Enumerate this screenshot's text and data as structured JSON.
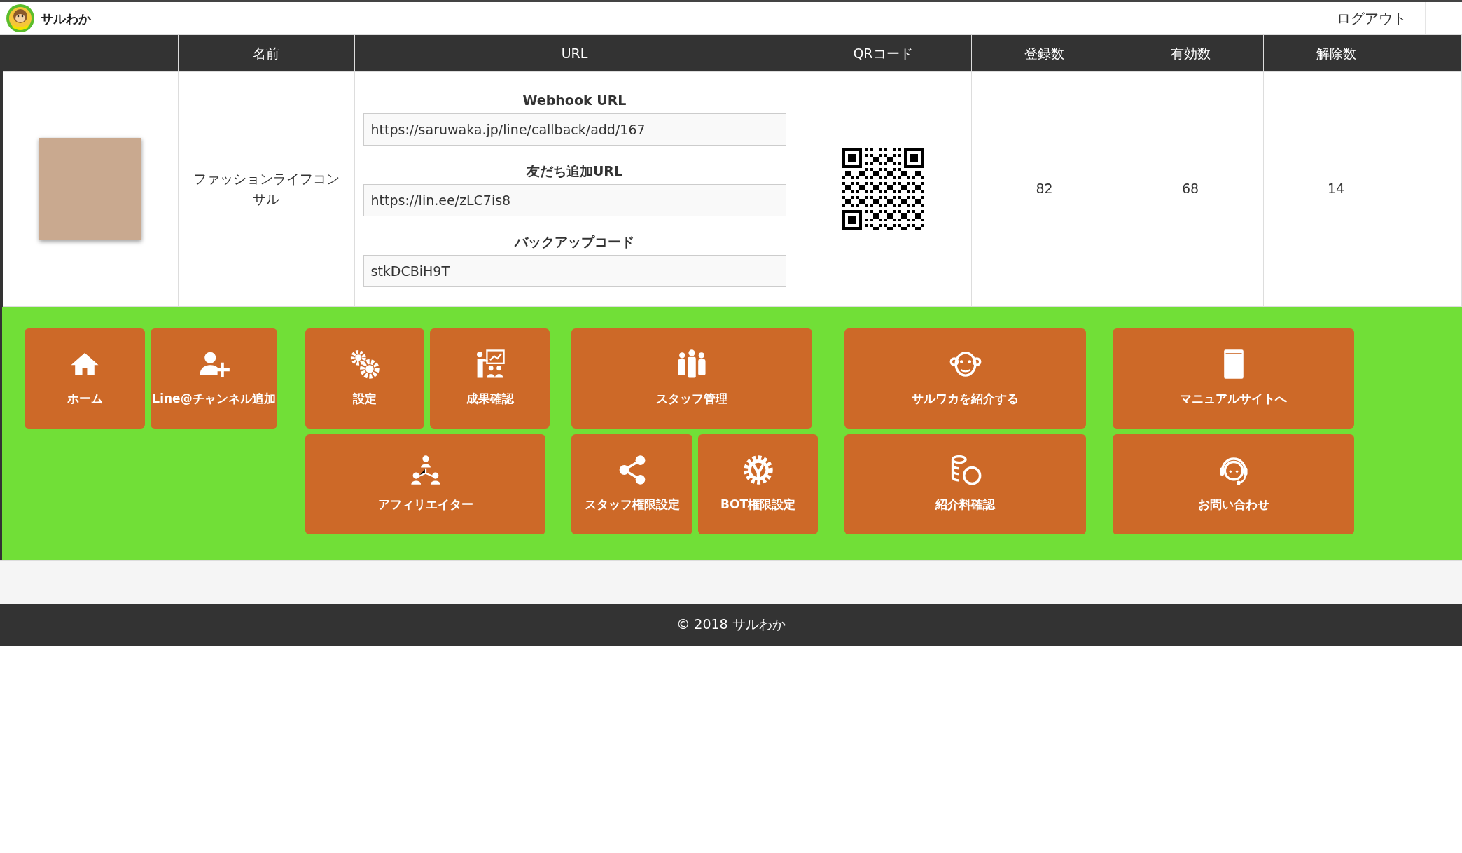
{
  "header": {
    "logo_text": "サルわか",
    "logout": "ログアウト"
  },
  "table": {
    "columns": [
      "名前",
      "URL",
      "QRコード",
      "登録数",
      "有効数",
      "解除数"
    ],
    "rows": [
      {
        "name": "ファッションライフコンサル",
        "url_sections": [
          {
            "label": "Webhook URL",
            "value": "https://saruwaka.jp/line/callback/add/167"
          },
          {
            "label": "友だち追加URL",
            "value": "https://lin.ee/zLC7is8"
          },
          {
            "label": "バックアップコード",
            "value": "stkDCBiH9T"
          }
        ],
        "registered": "82",
        "active": "68",
        "removed": "14"
      }
    ]
  },
  "menu_groups": [
    {
      "rows": [
        [
          {
            "label": "ホーム"
          },
          {
            "label": "Line@チャンネル追加"
          }
        ]
      ]
    },
    {
      "rows": [
        [
          {
            "label": "設定"
          },
          {
            "label": "成果確認"
          }
        ],
        [
          {
            "label": "アフィリエイター"
          }
        ]
      ]
    },
    {
      "rows": [
        [
          {
            "label": "スタッフ管理"
          }
        ],
        [
          {
            "label": "スタッフ権限設定"
          },
          {
            "label": "BOT権限設定"
          }
        ]
      ]
    },
    {
      "rows": [
        [
          {
            "label": "サルワカを紹介する"
          }
        ],
        [
          {
            "label": "紹介料確認"
          }
        ]
      ]
    },
    {
      "rows": [
        [
          {
            "label": "マニュアルサイトへ"
          }
        ],
        [
          {
            "label": "お問い合わせ"
          }
        ]
      ]
    }
  ],
  "footer": {
    "copyright": "© 2018 サルわか"
  }
}
